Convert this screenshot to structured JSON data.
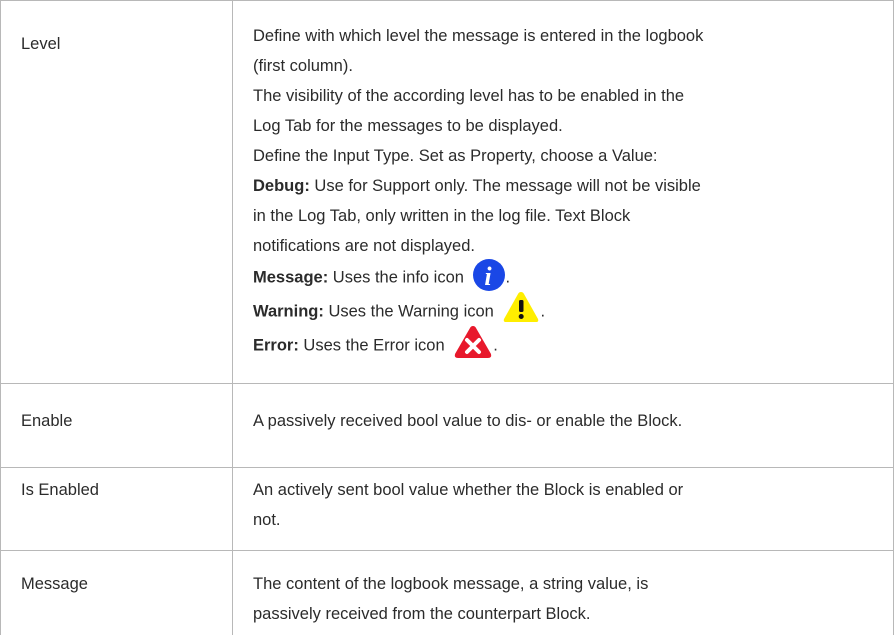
{
  "rows": [
    {
      "name": "Level",
      "lines": [
        "Define with which level the message is entered in the logbook",
        "(first column).",
        "The visibility of the according level has to be enabled in the",
        "Log Tab for the messages to be displayed.",
        "Define the Input Type. Set as Property, choose a Value:"
      ],
      "debug": {
        "label": "Debug:",
        "line1": " Use for Support only. The message will not be visible",
        "line2": "in the Log Tab, only written in the log file. Text Block",
        "line3": "notifications are not displayed."
      },
      "message": {
        "label": "Message:",
        "text": " Uses the info icon",
        "icon": "info-icon",
        "suffix": "."
      },
      "warning": {
        "label": "Warning:",
        "text": " Uses the Warning icon",
        "icon": "warning-icon",
        "suffix": "."
      },
      "error": {
        "label": "Error:",
        "text": " Uses the Error icon",
        "icon": "error-icon",
        "suffix": "."
      }
    },
    {
      "name": "Enable",
      "lines": [
        "A passively received bool value to dis- or enable the Block."
      ]
    },
    {
      "name": "Is Enabled",
      "lines": [
        "An actively sent bool value whether the Block is enabled or",
        "not."
      ]
    },
    {
      "name": "Message",
      "lines": [
        "The content of the logbook message, a string value, is",
        "passively received from the counterpart Block."
      ]
    }
  ],
  "colors": {
    "info": "#1a47e6",
    "warning": "#ffee00",
    "error": "#e8192c",
    "border": "#b8b8b8"
  }
}
